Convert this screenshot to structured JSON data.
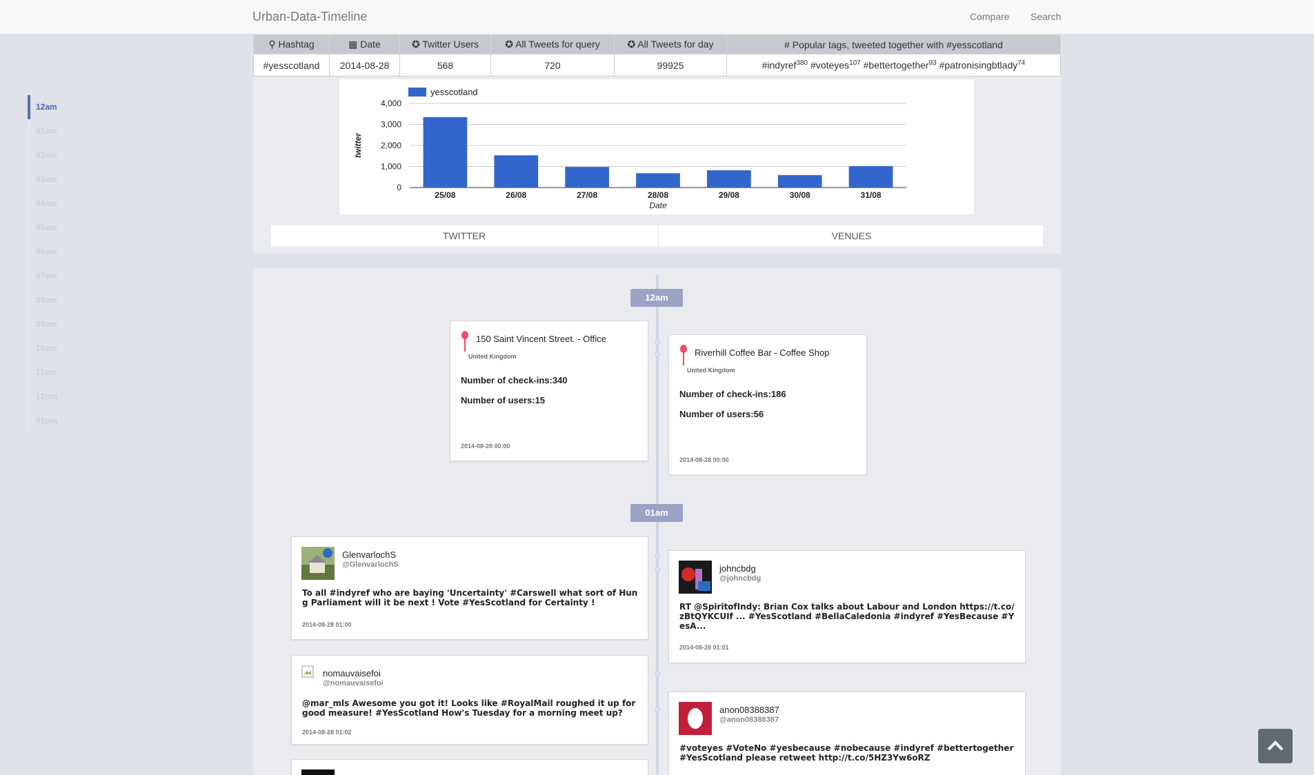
{
  "nav": {
    "brand": "Urban-Data-Timeline",
    "compare": "Compare",
    "search": "Search"
  },
  "sidebar": {
    "items": [
      "12am",
      "01am",
      "02am",
      "03am",
      "04am",
      "05am",
      "06am",
      "07am",
      "08am",
      "09am",
      "10am",
      "11am",
      "12pm",
      "01pm"
    ],
    "active": "12am"
  },
  "stats": {
    "headers": {
      "hashtag": "Hashtag",
      "date": "Date",
      "users": "Twitter Users",
      "query": "All Tweets for query",
      "day": "All Tweets for day",
      "popular": "Popular tags, tweeted together with #yesscotland"
    },
    "values": {
      "hashtag": "#yesscotland",
      "date": "2014-08-28",
      "users": "568",
      "query": "720",
      "day": "99925"
    },
    "tags": [
      {
        "tag": "#indyref",
        "count": "380"
      },
      {
        "tag": "#voteyes",
        "count": "107"
      },
      {
        "tag": "#bettertogether",
        "count": "93"
      },
      {
        "tag": "#patronisingbtlady",
        "count": "74"
      }
    ]
  },
  "chart_data": {
    "type": "bar",
    "categories": [
      "25/08",
      "26/08",
      "27/08",
      "28/08",
      "29/08",
      "30/08",
      "31/08"
    ],
    "series": [
      {
        "name": "yesscotland",
        "values": [
          3350,
          1530,
          980,
          680,
          820,
          590,
          1020
        ]
      }
    ],
    "xlabel": "Date",
    "ylabel": "twitter",
    "ylim": [
      0,
      4000
    ],
    "yticks": [
      "0",
      "1,000",
      "2,000",
      "3,000",
      "4,000"
    ],
    "legend": "top-left",
    "grid": true,
    "color": "#3366cc"
  },
  "tabs": {
    "twitter": "TWITTER",
    "venues": "VENUES"
  },
  "timeline": {
    "hours": [
      "12am",
      "01am"
    ],
    "venues": [
      {
        "name": "150 Saint Vincent Street. - Office",
        "country": "United Kingdom",
        "checkins": "Number of check-ins:340",
        "users": "Number of users:15",
        "time": "2014-08-28 00:00"
      },
      {
        "name": "Riverhill Coffee Bar - Coffee Shop",
        "country": "United Kingdom",
        "checkins": "Number of check-ins:186",
        "users": "Number of users:56",
        "time": "2014-08-28 00:00"
      }
    ],
    "tweets": [
      {
        "name": "GlenvarlochS",
        "handle": "@GlenvarlochS",
        "text": "To all #indyref who are baying 'Uncertainty' #Carswell what sort of Hung Parliament will it be next ! Vote #YesScotland for Certainty !",
        "time": "2014-08-28 01:00"
      },
      {
        "name": "johncbdg",
        "handle": "@johncbdg",
        "text": "RT @SpiritofIndy: Brian Cox talks about Labour and London https://t.co/zBtQYKCUIf ... #YesScotland #BellaCaledonia #indyref #YesBecause #YesA...",
        "time": "2014-08-28 01:01"
      },
      {
        "name": "nomauvaisefoi",
        "handle": "@nomauvaisefoi",
        "text": "@mar_mls Awesome you got it! Looks like #RoyalMail roughed it up for good measure! #YesScotland How's Tuesday for a morning meet up?",
        "time": "2014-08-28 01:02"
      },
      {
        "name": "anon08388387",
        "handle": "@anon08388387",
        "text": "#voteyes #VoteNo #yesbecause #nobecause #indyref #bettertogether #YesScotland please retweet http://t.co/5HZ3Yw6oRZ",
        "time": ""
      }
    ]
  }
}
